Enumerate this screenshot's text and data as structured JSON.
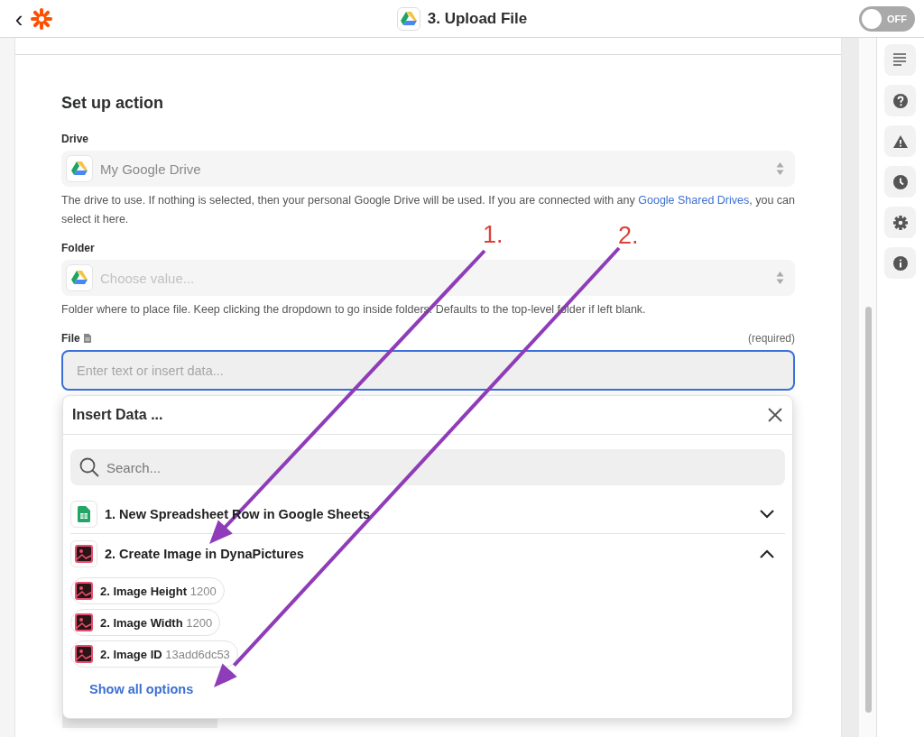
{
  "header": {
    "back": "‹",
    "title": "3. Upload File",
    "toggle": {
      "label": "OFF",
      "on": false
    }
  },
  "section_title": "Set up action",
  "fields": [
    {
      "kind": "select",
      "label": "Drive",
      "value": "My Google Drive",
      "help": "The drive to use. If nothing is selected, then your personal Google Drive will be used. If you are connected with any ",
      "link": "Google Shared Drives",
      "help_after": ", you can select it here."
    },
    {
      "kind": "select",
      "label": "Folder",
      "placeholder": "Choose value...",
      "help": "Folder where to place file. Keep clicking the dropdown to go inside folders. Defaults to the top-level folder if left blank."
    },
    {
      "kind": "text",
      "label": "File",
      "required": "(required)",
      "placeholder": "Enter text or insert data..."
    }
  ],
  "insert_data": {
    "title": "Insert Data ...",
    "search": {
      "placeholder": "Search..."
    },
    "groups": [
      {
        "kind": "sheets",
        "label": "1. New Spreadsheet Row in Google Sheets",
        "expanded": false
      },
      {
        "kind": "image",
        "label": "2. Create Image in DynaPictures",
        "expanded": true,
        "items": [
          {
            "label": "2. Image Height",
            "value": "1200"
          },
          {
            "label": "2. Image Width",
            "value": "1200"
          },
          {
            "label": "2. Image ID",
            "value": "13add6dc53"
          }
        ]
      }
    ],
    "show_all": "Show all options"
  },
  "annotations": [
    {
      "label": "1."
    },
    {
      "label": "2."
    }
  ]
}
